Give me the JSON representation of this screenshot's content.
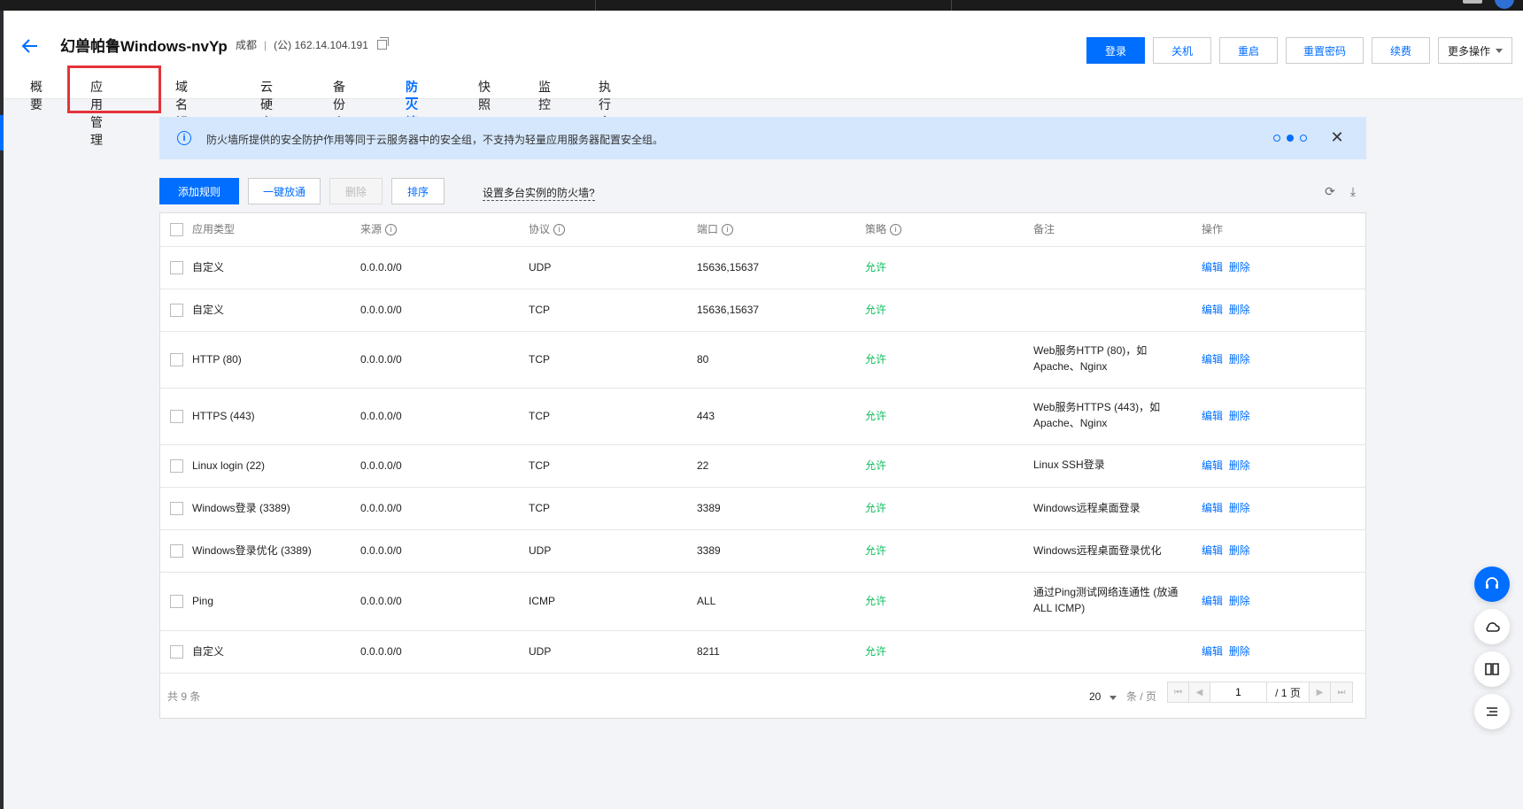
{
  "instance": {
    "name": "幻兽帕鲁Windows-nvYp",
    "region": "成都",
    "separator": "|",
    "ip": "(公) 162.14.104.191"
  },
  "header_buttons": [
    "登录",
    "关机",
    "重启",
    "重置密码",
    "续费",
    "更多操作"
  ],
  "tabs": [
    "概要",
    "应用管理",
    "域名解析",
    "云硬盘",
    "备份点",
    "防火墙",
    "快照",
    "监控",
    "执行命令"
  ],
  "active_tab": "防火墙",
  "highlighted_tab": "应用管理",
  "notice": {
    "text": "防火墙所提供的安全防护作用等同于云服务器中的安全组，不支持为轻量应用服务器配置安全组。",
    "close_glyph": "✕"
  },
  "toolbar": {
    "add_rule": "添加规则",
    "one_click": "一键放通",
    "delete": "删除",
    "sort": "排序",
    "multi_instance_link": "设置多台实例的防火墙?"
  },
  "table": {
    "headers": [
      "应用类型",
      "来源",
      "协议",
      "端口",
      "策略",
      "备注",
      "操作"
    ],
    "rows": [
      {
        "type": "自定义",
        "source": "0.0.0.0/0",
        "protocol": "UDP",
        "port": "15636,15637",
        "policy": "允许",
        "note1": "",
        "note2": ""
      },
      {
        "type": "自定义",
        "source": "0.0.0.0/0",
        "protocol": "TCP",
        "port": "15636,15637",
        "policy": "允许",
        "note1": "",
        "note2": ""
      },
      {
        "type": "HTTP (80)",
        "source": "0.0.0.0/0",
        "protocol": "TCP",
        "port": "80",
        "policy": "允许",
        "note1": "Web服务HTTP (80)，如",
        "note2": "Apache、Nginx"
      },
      {
        "type": "HTTPS (443)",
        "source": "0.0.0.0/0",
        "protocol": "TCP",
        "port": "443",
        "policy": "允许",
        "note1": "Web服务HTTPS (443)，如",
        "note2": "Apache、Nginx"
      },
      {
        "type": "Linux login (22)",
        "source": "0.0.0.0/0",
        "protocol": "TCP",
        "port": "22",
        "policy": "允许",
        "note1": "Linux SSH登录",
        "note2": ""
      },
      {
        "type": "Windows登录 (3389)",
        "source": "0.0.0.0/0",
        "protocol": "TCP",
        "port": "3389",
        "policy": "允许",
        "note1": "Windows远程桌面登录",
        "note2": ""
      },
      {
        "type": "Windows登录优化 (3389)",
        "source": "0.0.0.0/0",
        "protocol": "UDP",
        "port": "3389",
        "policy": "允许",
        "note1": "Windows远程桌面登录优化",
        "note2": ""
      },
      {
        "type": "Ping",
        "source": "0.0.0.0/0",
        "protocol": "ICMP",
        "port": "ALL",
        "policy": "允许",
        "note1": "通过Ping测试网络连通性 (放通",
        "note2": "ALL ICMP)"
      },
      {
        "type": "自定义",
        "source": "0.0.0.0/0",
        "protocol": "UDP",
        "port": "8211",
        "policy": "允许",
        "note1": "",
        "note2": ""
      }
    ],
    "edit_label": "编辑",
    "delete_label": "删除"
  },
  "pagination": {
    "total_text": "共 9 条",
    "page_size": "20",
    "page_size_unit": "条 / 页",
    "current_page": "1",
    "total_pages_text": "/ 1 页"
  },
  "colors": {
    "accent": "#006eff",
    "allow": "#0abf5b",
    "notice_bg": "#d5e7fd",
    "highlight_box": "#e5333a"
  }
}
